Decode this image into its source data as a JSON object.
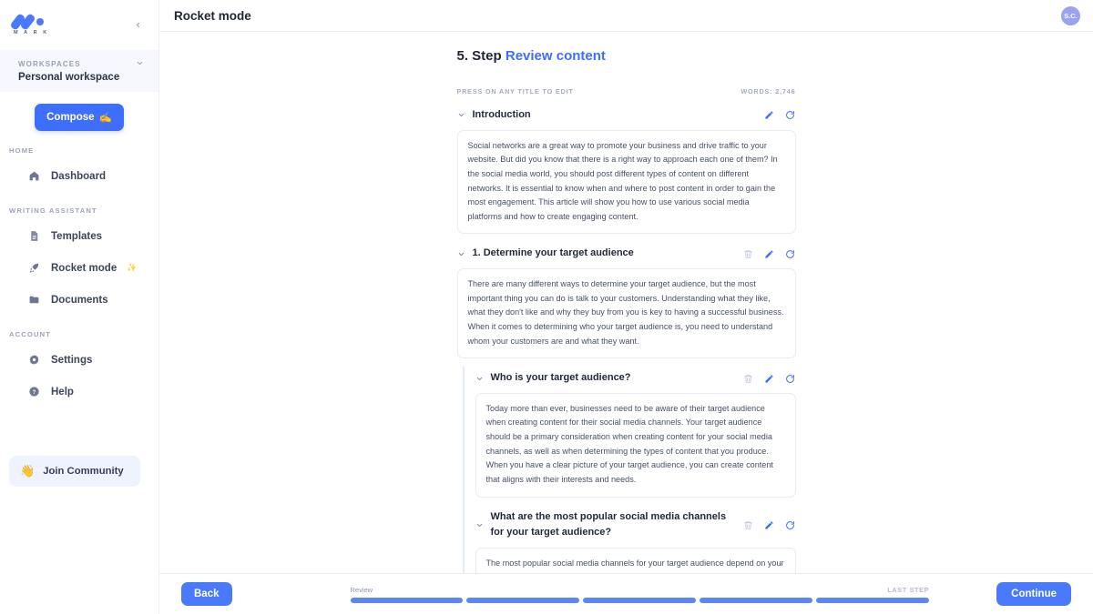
{
  "brand": {
    "logo_text": "M A R K",
    "collapse_icon": "chevron-left-icon"
  },
  "sidebar": {
    "workspaces_label": "WORKSPACES",
    "workspace_name": "Personal workspace",
    "compose_label": "Compose",
    "compose_emoji": "✍️",
    "groups": [
      {
        "label": "HOME",
        "items": [
          {
            "label": "Dashboard",
            "icon": "home-icon"
          }
        ]
      },
      {
        "label": "WRITING ASSISTANT",
        "items": [
          {
            "label": "Templates",
            "icon": "document-icon"
          },
          {
            "label": "Rocket mode",
            "icon": "rocket-icon",
            "suffix": "✨"
          },
          {
            "label": "Documents",
            "icon": "folder-icon"
          }
        ]
      },
      {
        "label": "ACCOUNT",
        "items": [
          {
            "label": "Settings",
            "icon": "gear-icon"
          },
          {
            "label": "Help",
            "icon": "help-circle-icon"
          }
        ]
      }
    ],
    "community_label": "Join Community",
    "community_emoji": "👋"
  },
  "topbar": {
    "title": "Rocket mode",
    "avatar_initials": "S.C."
  },
  "doc": {
    "step_prefix": "5. Step",
    "step_name": "Review content",
    "hint": "PRESS ON ANY TITLE TO EDIT",
    "word_count": "WORDS: 2,746",
    "sections": [
      {
        "title": "Introduction",
        "nested": false,
        "has_trash": false,
        "body": "Social networks are a great way to promote your business and drive traffic to your website. But did you know that there is a right way to approach each one of them? In the social media world, you should post different types of content on different networks. It is essential to know when and where to post content in order to gain the most engagement. This article will show you how to use various social media platforms and how to create engaging content."
      },
      {
        "title": "1. Determine your target audience",
        "nested": false,
        "has_trash": true,
        "body": "There are many different ways to determine your target audience, but the most important thing you can do is talk to your customers. Understanding what they like, what they don't like and why they buy from you is key to having a successful business. When it comes to determining who your target audience is, you need to understand whom your customers are and what they want."
      },
      {
        "title": "Who is your target audience?",
        "nested": true,
        "has_trash": true,
        "body": "Today more than ever, businesses need to be aware of their target audience when creating content for their social media channels. Your target audience should be a primary consideration when creating content for your social media channels, as well as when determining the types of content that you produce. When you have a clear picture of your target audience, you can create content that aligns with their interests and needs."
      },
      {
        "title": "What are the most popular social media channels for your target audience?",
        "nested": true,
        "has_trash": true,
        "clipped": true,
        "body": "The most popular social media channels for your target audience depend on your business, but there are some general guidelines. If"
      }
    ]
  },
  "footer": {
    "back_label": "Back",
    "continue_label": "Continue",
    "progress_label": "Review",
    "progress_last": "LAST STEP",
    "progress_segments": [
      true,
      true,
      true,
      true,
      true
    ]
  },
  "colors": {
    "accent": "#3e6efc",
    "button": "#4a7afc",
    "progress_fill": "#5b86fb",
    "avatar": "#9aa2f2"
  }
}
